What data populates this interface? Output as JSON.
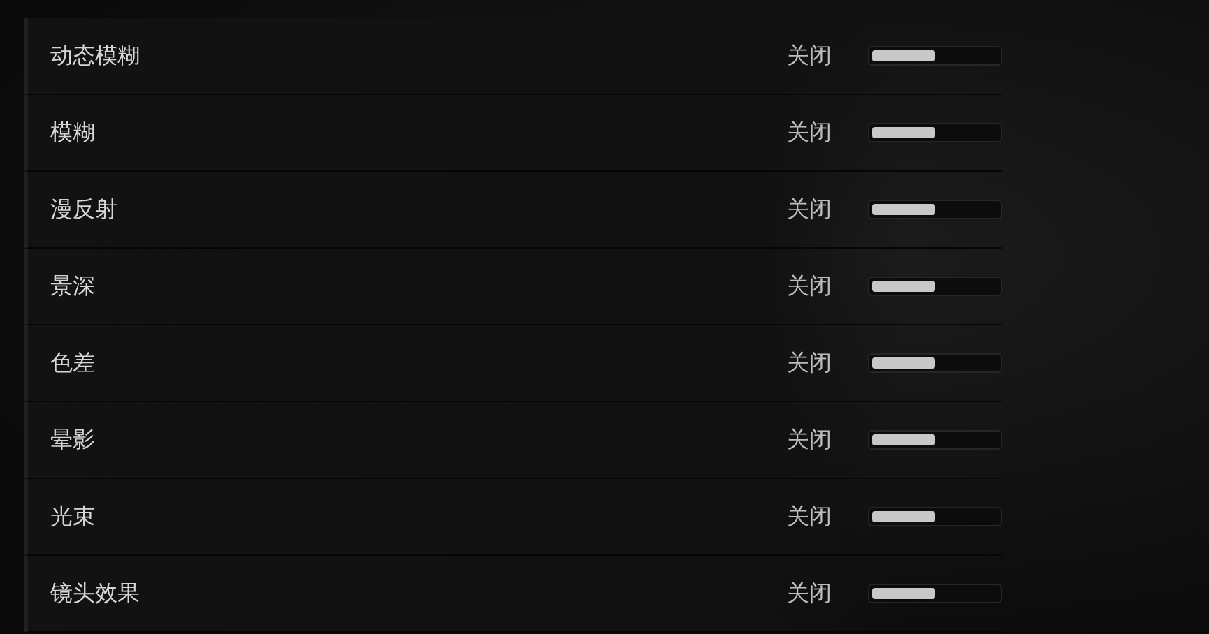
{
  "settings": [
    {
      "label": "动态模糊",
      "value": "关闭",
      "level": 0.5
    },
    {
      "label": "模糊",
      "value": "关闭",
      "level": 0.5
    },
    {
      "label": "漫反射",
      "value": "关闭",
      "level": 0.5
    },
    {
      "label": "景深",
      "value": "关闭",
      "level": 0.5
    },
    {
      "label": "色差",
      "value": "关闭",
      "level": 0.5
    },
    {
      "label": "晕影",
      "value": "关闭",
      "level": 0.5
    },
    {
      "label": "光束",
      "value": "关闭",
      "level": 0.5
    },
    {
      "label": "镜头效果",
      "value": "关闭",
      "level": 0.5
    }
  ]
}
